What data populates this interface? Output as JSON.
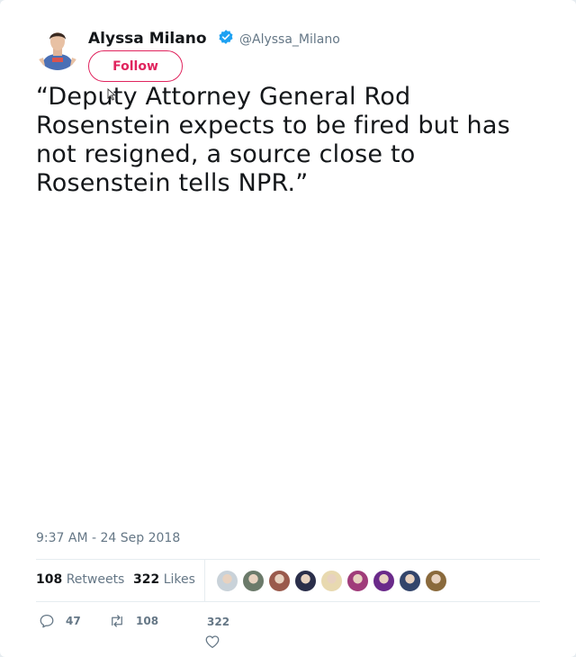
{
  "author": {
    "name": "Alyssa Milano",
    "handle": "@Alyssa_Milano",
    "verified": true,
    "avatar_icon": "profile-photo"
  },
  "follow_button": {
    "label": "Follow"
  },
  "tweet": {
    "text": "“Deputy Attorney General Rod Rosenstein expects to be fired but has not resigned, a source close to Rosenstein tells NPR.”",
    "timestamp": "9:37 AM - 24 Sep 2018"
  },
  "stats": {
    "retweets_count": "108",
    "retweets_label": "Retweets",
    "likes_count": "322",
    "likes_label": "Likes",
    "liker_avatars": [
      "#c9d2d9",
      "#6b7a6a",
      "#9a5a4c",
      "#2a2e4a",
      "#e8d9b0",
      "#a03c7a",
      "#6a2a8a",
      "#33456b",
      "#8a6a3c"
    ]
  },
  "actions": {
    "reply_count": "47",
    "retweet_count": "108",
    "like_count": "322"
  },
  "colors": {
    "accent": "#e0245e",
    "verified_blue": "#1da1f2",
    "muted": "#657786"
  }
}
